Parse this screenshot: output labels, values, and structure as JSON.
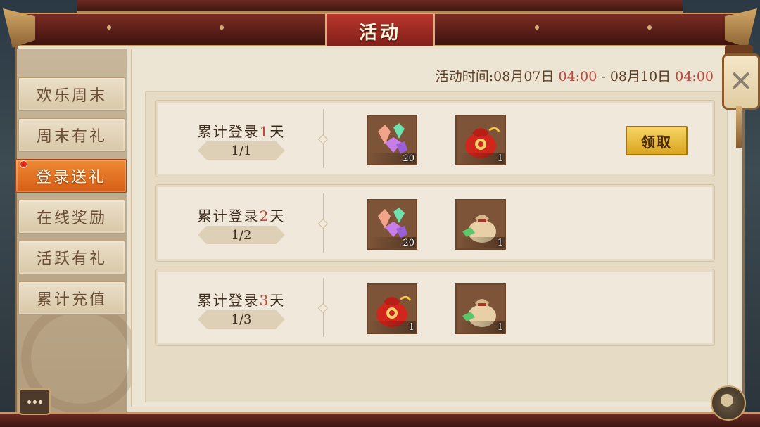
{
  "header": {
    "title": "活动"
  },
  "sidebar": {
    "tabs": [
      {
        "label": "欢乐周末",
        "active": false
      },
      {
        "label": "周末有礼",
        "active": false
      },
      {
        "label": "登录送礼",
        "active": true
      },
      {
        "label": "在线奖励",
        "active": false
      },
      {
        "label": "活跃有礼",
        "active": false
      },
      {
        "label": "累计充值",
        "active": false
      }
    ]
  },
  "event_time": {
    "prefix": "活动时间:",
    "start_date": "08月07日",
    "start_time": "04:00",
    "separator": "-",
    "end_date": "08月10日",
    "end_time": "04:00"
  },
  "rewards": [
    {
      "title_prefix": "累计登录",
      "day": "1",
      "title_suffix": "天",
      "progress": "1/1",
      "items": [
        {
          "icon": "gems-icon",
          "count": "20"
        },
        {
          "icon": "red-lucky-bag-icon",
          "count": "1"
        }
      ],
      "claim_label": "领取"
    },
    {
      "title_prefix": "累计登录",
      "day": "2",
      "title_suffix": "天",
      "progress": "1/2",
      "items": [
        {
          "icon": "gems-icon",
          "count": "20"
        },
        {
          "icon": "cloth-pouch-icon",
          "count": "1"
        }
      ]
    },
    {
      "title_prefix": "累计登录",
      "day": "3",
      "title_suffix": "天",
      "progress": "1/3",
      "items": [
        {
          "icon": "red-lucky-bag-icon",
          "count": "1"
        },
        {
          "icon": "cloth-pouch-icon",
          "count": "1"
        }
      ]
    }
  ],
  "colors": {
    "highlight_red": "#c0453a",
    "active_tab": "#e2711f",
    "claim_button": "#e8bb3a"
  }
}
